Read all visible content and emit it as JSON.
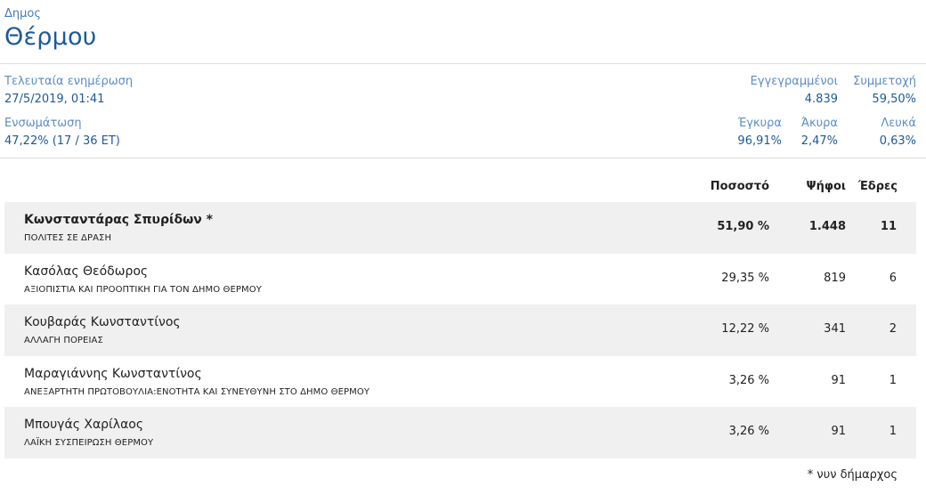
{
  "header": {
    "label": "Δημος",
    "name": "Θέρμου"
  },
  "stats": {
    "last_update_label": "Τελευταία ενημέρωση",
    "last_update_value": "27/5/2019, 01:41",
    "integration_label": "Ενσωμάτωση",
    "integration_value": "47,22% (17 / 36 ΕΤ)",
    "registered_label": "Εγγεγραμμένοι",
    "registered_value": "4.839",
    "turnout_label": "Συμμετοχή",
    "turnout_value": "59,50%",
    "valid_label": "Έγκυρα",
    "valid_value": "96,91%",
    "invalid_label": "Άκυρα",
    "invalid_value": "2,47%",
    "blank_label": "Λευκά",
    "blank_value": "0,63%"
  },
  "table": {
    "headers": {
      "percent": "Ποσοστό",
      "votes": "Ψήφοι",
      "seats": "Έδρες"
    },
    "rows": [
      {
        "name": "Κωνσταντάρας Σπυρίδων *",
        "party": "ΠΟΛΙΤΕΣ ΣΕ ΔΡΑΣΗ",
        "percent": "51,90 %",
        "votes": "1.448",
        "seats": "11"
      },
      {
        "name": "Κασόλας Θεόδωρος",
        "party": "ΑΞΙΟΠΙΣΤΙΑ ΚΑΙ ΠΡΟΟΠΤΙΚΗ ΓΙΑ ΤΟΝ ΔΗΜΟ ΘΕΡΜΟΥ",
        "percent": "29,35 %",
        "votes": "819",
        "seats": "6"
      },
      {
        "name": "Κουβαράς Κωνσταντίνος",
        "party": "ΑΛΛΑΓΗ ΠΟΡΕΙΑΣ",
        "percent": "12,22 %",
        "votes": "341",
        "seats": "2"
      },
      {
        "name": "Μαραγιάννης Κωνσταντίνος",
        "party": "ΑΝΕΞΑΡΤΗΤΗ ΠΡΩΤΟΒΟΥΛΙΑ:ΕΝΟΤΗΤΑ ΚΑΙ ΣΥΝΕΥΘΥΝΗ ΣΤΟ ΔΗΜΟ ΘΕΡΜΟΥ",
        "percent": "3,26 %",
        "votes": "91",
        "seats": "1"
      },
      {
        "name": "Μπουγάς Χαρίλαος",
        "party": "ΛΑΪΚΗ ΣΥΣΠΕΙΡΩΣΗ ΘΕΡΜΟΥ",
        "percent": "3,26 %",
        "votes": "91",
        "seats": "1"
      }
    ]
  },
  "footnote": "* νυν δήμαρχος",
  "colors": {
    "accent": "#1d5a96",
    "label_blue": "#5b8cc4",
    "row_shade": "#f0f0f1"
  }
}
